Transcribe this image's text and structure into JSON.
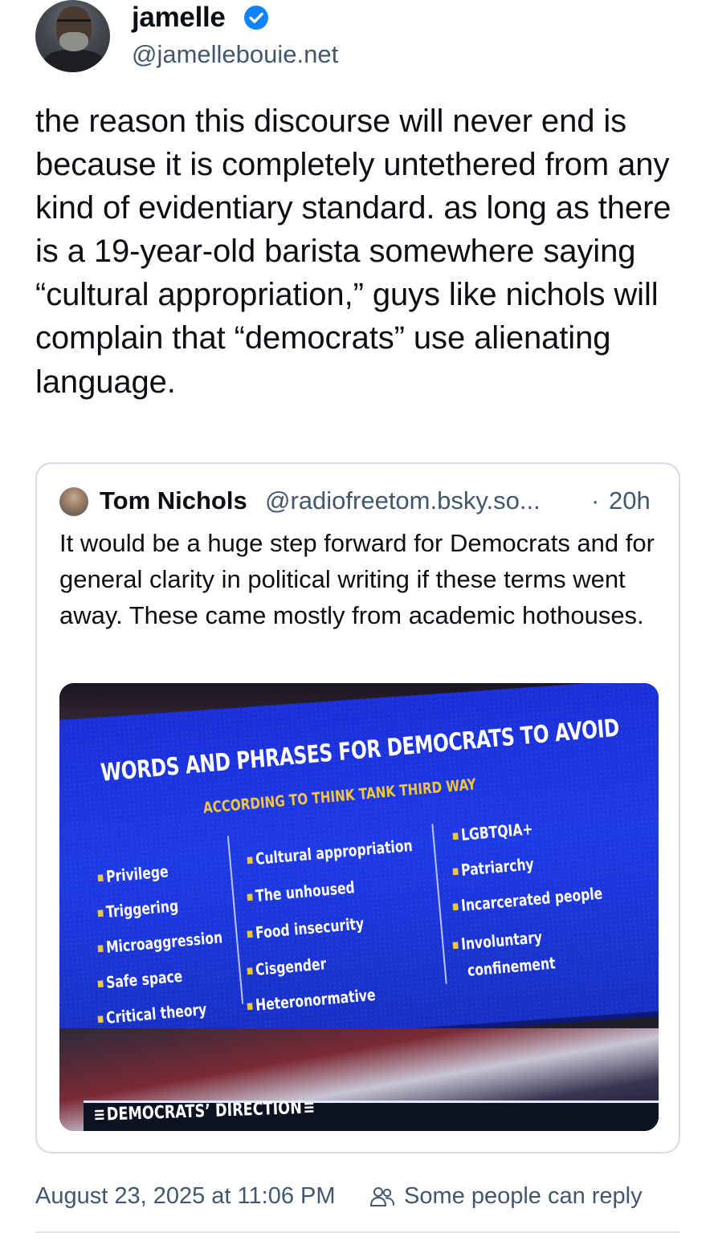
{
  "author": {
    "display_name": "jamelle",
    "handle": "@jamellebouie.net",
    "verified": true,
    "verified_icon": "blue-check-icon",
    "verified_color": "#1083fe"
  },
  "post": {
    "text": "the reason this discourse will never end is because it is completely untethered from any kind of evidentiary standard. as long as there is a 19-year-old barista somewhere saying “cultural appropriation,” guys like nichols will complain that “democrats” use alienating language."
  },
  "quote": {
    "display_name": "Tom Nichols",
    "handle": "@radiofreetom.bsky.so...",
    "separator": "·",
    "time": "20h",
    "text": "It would be a huge step forward for Democrats and for general clarity in political writing if these terms went away. These came mostly from academic hothouses.",
    "image": {
      "title": "WORDS AND PHRASES FOR DEMOCRATS TO AVOID",
      "subtitle": "ACCORDING TO THINK TANK THIRD WAY",
      "column_1": [
        "Privilege",
        "Triggering",
        "Microaggression",
        "Safe space",
        "Critical theory"
      ],
      "column_2": [
        "Cultural appropriation",
        "The unhoused",
        "Food insecurity",
        "Cisgender",
        "Heteronormative"
      ],
      "column_3": [
        "LGBTQIA+",
        "Patriarchy",
        "Incarcerated people",
        "Involuntary",
        "confinement"
      ],
      "banner": "DEMOCRATS’ DIRECTION",
      "accent_color": "#f2c63a",
      "screen_color": "#1e3ae6"
    }
  },
  "footer": {
    "date": "August 23, 2025 at 11:06 PM",
    "reply_icon": "people-icon",
    "reply_setting": "Some people can reply"
  },
  "colors": {
    "text": "#0b0f14",
    "muted": "#42576c",
    "border": "#d4dbe2"
  }
}
